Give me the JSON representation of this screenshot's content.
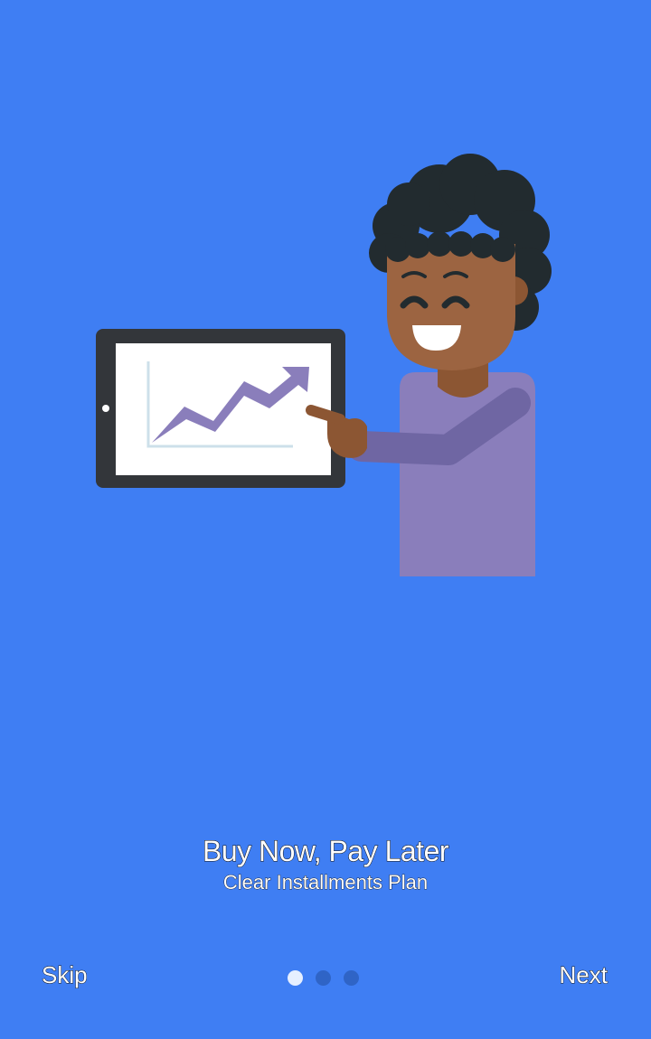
{
  "onboarding": {
    "title": "Buy Now, Pay Later",
    "subtitle": "Clear Installments Plan",
    "skip_label": "Skip",
    "next_label": "Next",
    "page_indicator": {
      "total": 3,
      "active_index": 0
    }
  },
  "colors": {
    "background": "#3f7ef3",
    "dot_active": "#e6efff",
    "dot_inactive": "#2f64c6"
  },
  "illustration": {
    "icon": "person-with-tablet-growth-chart-icon"
  }
}
